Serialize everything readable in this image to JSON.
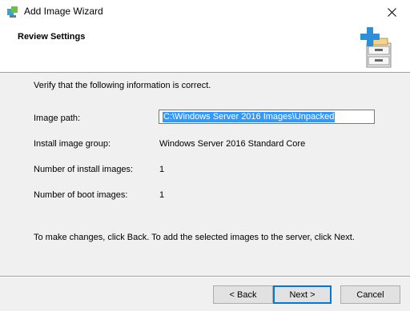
{
  "window": {
    "title": "Add Image Wizard",
    "icons": {
      "app": "wds-app-icon",
      "close": "close-icon"
    }
  },
  "header": {
    "title": "Review Settings",
    "graphic": "file-cabinet-add-icon"
  },
  "main": {
    "intro": "Verify that the following information is correct.",
    "rows": [
      {
        "label": "Image path:",
        "value": "C:\\Windows Server 2016 Images\\Unpacked"
      },
      {
        "label": "Install image group:",
        "value": "Windows Server 2016 Standard Core"
      },
      {
        "label": "Number of install images:",
        "value": "1"
      },
      {
        "label": "Number of boot images:",
        "value": "1"
      }
    ],
    "footer_note": "To make changes, click Back. To add the selected images to the server, click Next."
  },
  "buttons": {
    "back": "< Back",
    "next": "Next >",
    "cancel": "Cancel"
  },
  "colors": {
    "selection": "#3399ff",
    "default_button_border": "#0078d7",
    "icon_plus": "#2d8fd5"
  }
}
